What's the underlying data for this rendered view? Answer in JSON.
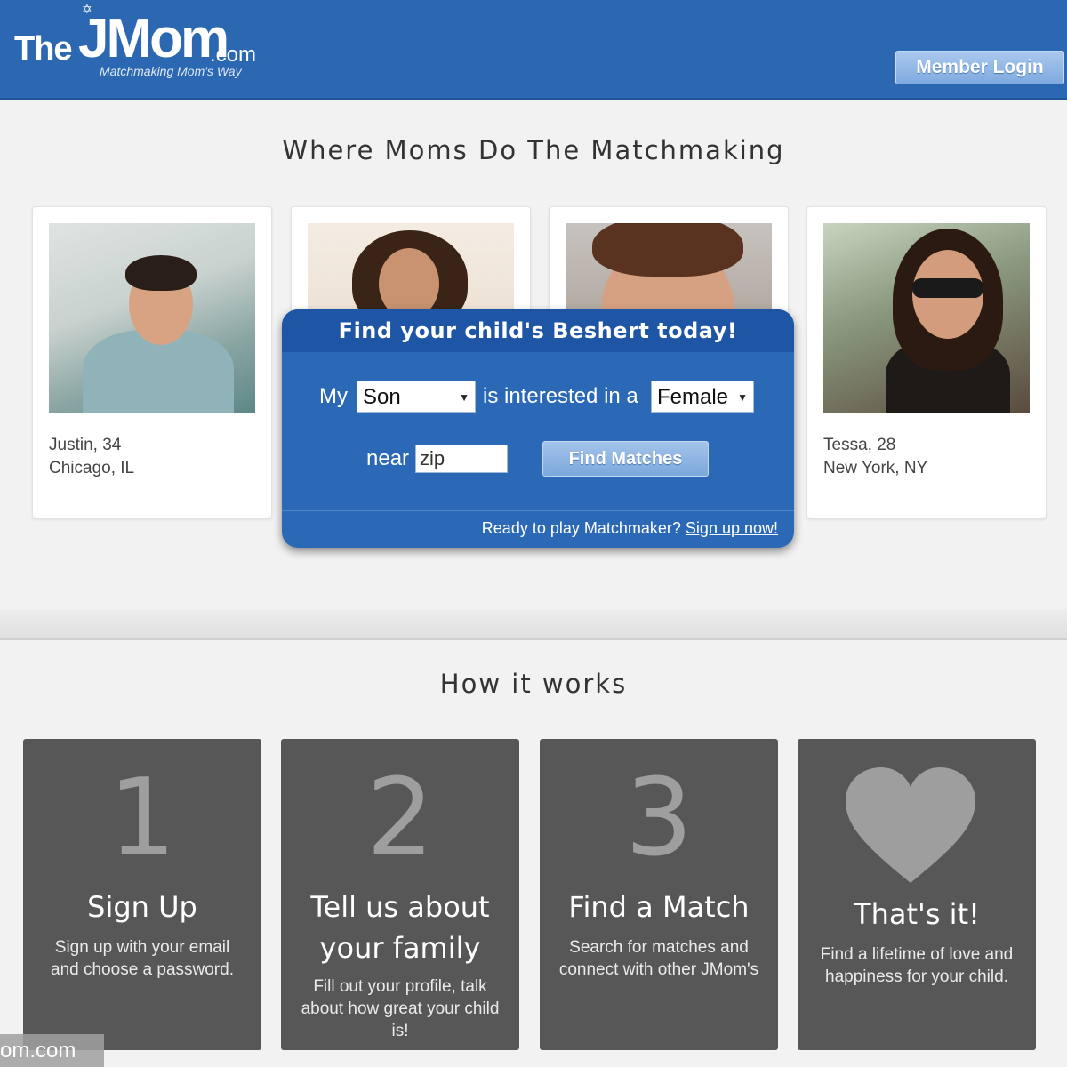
{
  "header": {
    "logo": {
      "the": "The",
      "jmom": "JMom",
      "com": ".com",
      "tagline": "Matchmaking Mom's Way"
    },
    "member_login": "Member Login"
  },
  "hero": {
    "title": "Where Moms Do The Matchmaking",
    "profiles": [
      {
        "name": "Justin, 34",
        "location": "Chicago, IL"
      },
      {
        "name": "",
        "location": ""
      },
      {
        "name": "",
        "location": ""
      },
      {
        "name": "Tessa, 28",
        "location": "New York, NY"
      }
    ]
  },
  "search": {
    "heading": "Find your child's Beshert today!",
    "my_label": "My",
    "child_select": "Son",
    "interested_label": "is interested in a",
    "gender_select": "Female",
    "near_label": "near",
    "zip_placeholder": "zip",
    "find_button": "Find Matches",
    "signup_prompt": "Ready to play Matchmaker?",
    "signup_link": "Sign up now!"
  },
  "how": {
    "title": "How it works",
    "steps": [
      {
        "num": "1",
        "title_line1": "Sign Up",
        "title_line2": "",
        "desc": "Sign up with your email and choose a password."
      },
      {
        "num": "2",
        "title_line1": "Tell us about",
        "title_line2": "your family",
        "desc": "Fill out your profile, talk about how great your child is!"
      },
      {
        "num": "3",
        "title_line1": "Find a Match",
        "title_line2": "",
        "desc": "Search for matches and connect with other JMom's"
      },
      {
        "num": "",
        "title_line1": "That's it!",
        "title_line2": "",
        "desc": "Find a lifetime of love and happiness for your child."
      }
    ]
  },
  "watermark": "om.com",
  "icons": {
    "heart": "heart-icon",
    "star": "star-of-david-icon",
    "dropdown": "chevron-down-icon"
  },
  "colors": {
    "header_blue": "#2b68b1",
    "panel_blue": "#2b69b6",
    "step_gray": "#575757"
  }
}
